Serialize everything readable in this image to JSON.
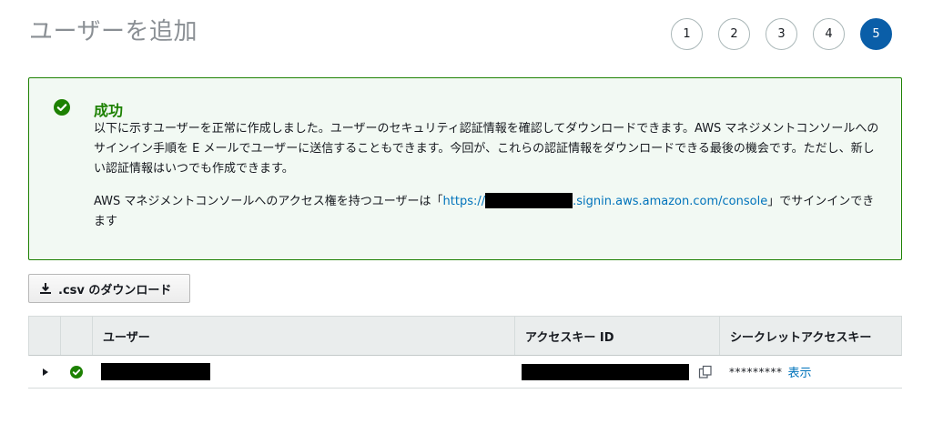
{
  "page": {
    "title": "ユーザーを追加"
  },
  "steps": [
    {
      "label": "1",
      "active": false
    },
    {
      "label": "2",
      "active": false
    },
    {
      "label": "3",
      "active": false
    },
    {
      "label": "4",
      "active": false
    },
    {
      "label": "5",
      "active": true
    }
  ],
  "alert": {
    "icon": "success-check-icon",
    "title": "成功",
    "body_1": "以下に示すユーザーを正常に作成しました。ユーザーのセキュリティ認証情報を確認してダウンロードできます。AWS マネジメントコンソールへのサインイン手順を E メールでユーザーに送信することもできます。今回が、これらの認証情報をダウンロードできる最後の機会です。ただし、新しい認証情報はいつでも作成できます。",
    "body_2_prefix": "AWS マネジメントコンソールへのアクセス権を持つユーザーは「",
    "url_prefix": "https://",
    "url_suffix": ".signin.aws.amazon.com/console",
    "body_2_suffix": "」でサインインできます"
  },
  "csv_button": {
    "label": ".csv のダウンロード",
    "icon": "download-icon"
  },
  "table": {
    "headers": [
      "",
      "",
      "ユーザー",
      "アクセスキー ID",
      "シークレットアクセスキー"
    ],
    "rows": [
      {
        "status_icon": "success-check-icon",
        "secret_mask": "*********",
        "show_label": "表示"
      }
    ]
  },
  "colors": {
    "success": "#1d8102",
    "link": "#0073bb",
    "active_step": "#0a5ea8"
  }
}
